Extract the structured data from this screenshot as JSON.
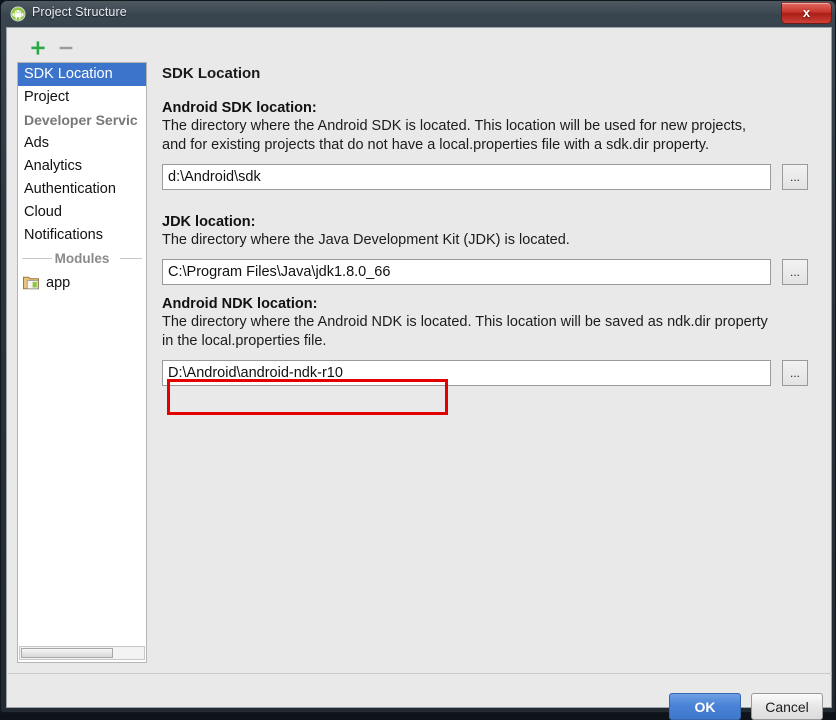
{
  "window": {
    "title": "Project Structure",
    "app_icon": "android-icon",
    "close_label": "x"
  },
  "sidebar": {
    "toolbar": {
      "add_icon": "plus-icon",
      "remove_icon": "minus-icon"
    },
    "items": [
      {
        "label": "SDK Location",
        "type": "item",
        "selected": true
      },
      {
        "label": "Project",
        "type": "item",
        "selected": false
      },
      {
        "label": "Developer Servic",
        "type": "group",
        "selected": false
      },
      {
        "label": "Ads",
        "type": "item",
        "selected": false
      },
      {
        "label": "Analytics",
        "type": "item",
        "selected": false
      },
      {
        "label": "Authentication",
        "type": "item",
        "selected": false
      },
      {
        "label": "Cloud",
        "type": "item",
        "selected": false
      },
      {
        "label": "Notifications",
        "type": "item",
        "selected": false
      }
    ],
    "modules_separator": "Modules",
    "modules": [
      {
        "label": "app",
        "icon": "module-folder-icon"
      }
    ]
  },
  "content": {
    "page_title": "SDK Location",
    "sections": [
      {
        "label": "Android SDK location:",
        "description": "The directory where the Android SDK is located. This location will be used for new projects,\nand for existing projects that do not have a local.properties file with a sdk.dir property.",
        "value": "d:\\Android\\sdk",
        "browse_label": "..."
      },
      {
        "label": "JDK location:",
        "description": "The directory where the Java Development Kit (JDK) is located.",
        "value": "C:\\Program Files\\Java\\jdk1.8.0_66",
        "browse_label": "..."
      },
      {
        "label": "Android NDK location:",
        "description": "The directory where the Android NDK is located. This location will be saved as ndk.dir property\nin the local.properties file.",
        "value": "D:\\Android\\android-ndk-r10",
        "browse_label": "..."
      }
    ]
  },
  "footer": {
    "ok_label": "OK",
    "cancel_label": "Cancel"
  },
  "annotation": {
    "color": "#e50000",
    "target": "android-ndk-location-field"
  }
}
